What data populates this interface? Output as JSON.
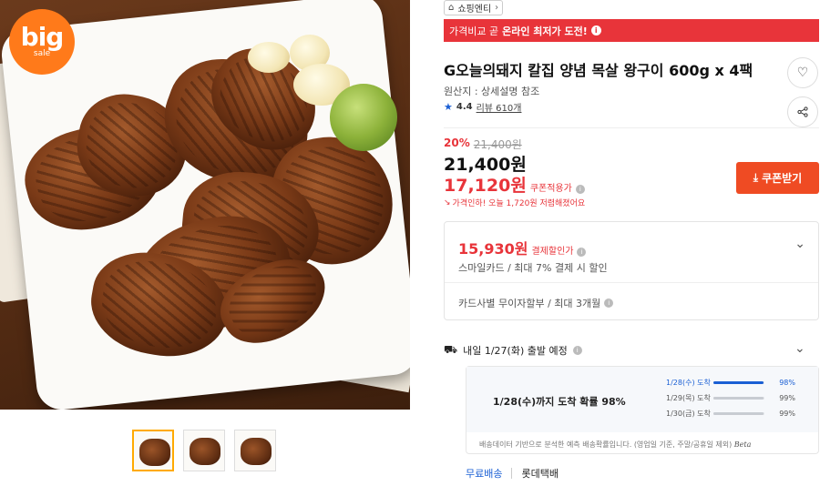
{
  "hero": {
    "badge_big": "big",
    "badge_small": "sale"
  },
  "thumbnails": [
    "thumb-1",
    "thumb-2",
    "thumb-3"
  ],
  "store": {
    "name": "쇼핑엔티",
    "icon_home": "⌂",
    "icon_chevron": "›"
  },
  "promo": {
    "prefix": "가격비교 곧",
    "highlight": "온라인 최저가 도전!",
    "icon": "i"
  },
  "product": {
    "title": "G오늘의돼지 칼집 양념 목살 왕구이 600g x 4팩",
    "origin": "원산지 : 상세설명 참조",
    "rating_score": "4.4",
    "rating_review": "리뷰 610개"
  },
  "price": {
    "discount_pct": "20%",
    "original": "21,400원",
    "main": "21,400원",
    "coupon_price": "17,120원",
    "coupon_label": "쿠폰적용가",
    "drop_text": "가격인하! 오늘 1,720원 저렴해졌어요",
    "coupon_button": "쿠폰받기"
  },
  "card": {
    "price": "15,930원",
    "label": "결제할인가",
    "sub": "스마일카드 / 최대 7% 결제 시 할인",
    "installment": "카드사별 무이자할부 / 최대 3개월"
  },
  "shipping": {
    "line": "내일 1/27(화) 출발 예정",
    "headline": "1/28(수)까지 도착 확률 98%",
    "rows": [
      {
        "date": "1/28(수) 도착",
        "pct": "98%",
        "value": 0.98,
        "color": "#1a5fd4"
      },
      {
        "date": "1/29(목) 도착",
        "pct": "99%",
        "value": 0.99,
        "color": "#c8ccd2"
      },
      {
        "date": "1/30(금) 도착",
        "pct": "99%",
        "value": 0.99,
        "color": "#c8ccd2"
      }
    ],
    "note": "배송데이터 기반으로 분석한 예측 배송확률입니다. (영업일 기준, 주말/공휴일 제외)",
    "beta": "Beta",
    "free_label": "무료배송",
    "carrier": "롯데택배"
  },
  "colors": {
    "accent_red": "#e8343a",
    "coupon_orange": "#ef4b23",
    "link_blue": "#1a5fd4",
    "badge_orange": "#ff7a1a"
  }
}
